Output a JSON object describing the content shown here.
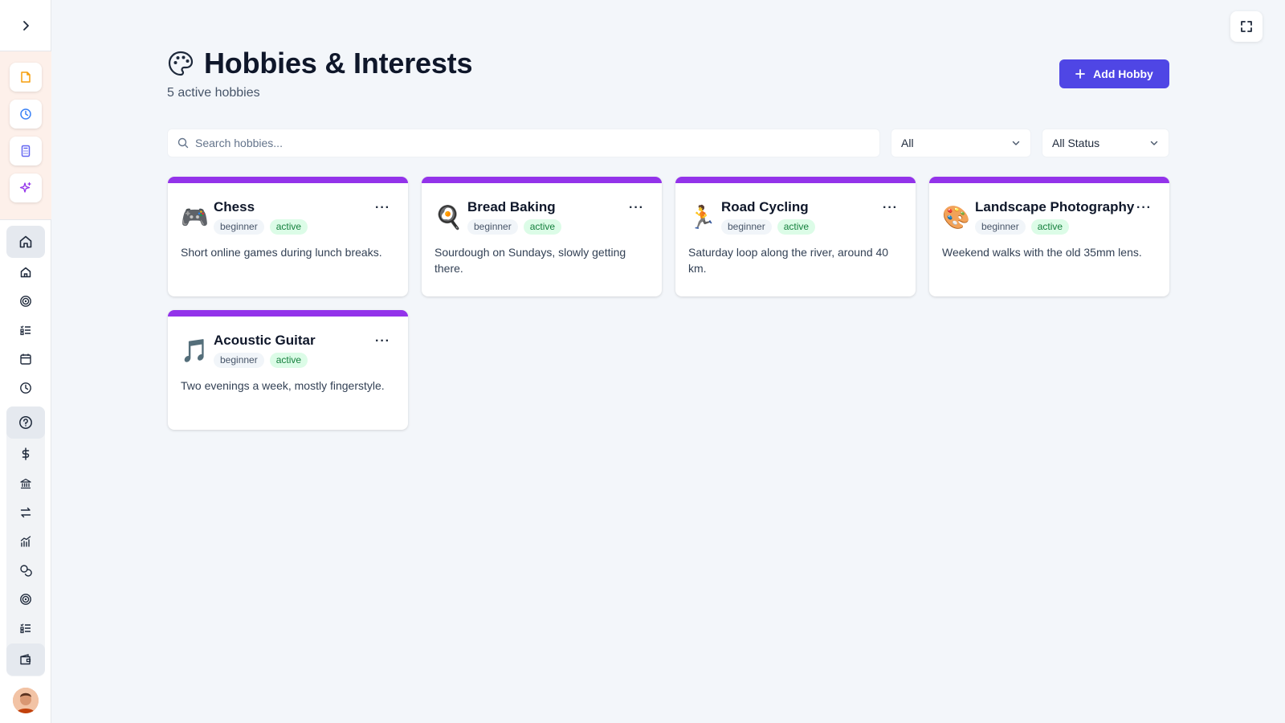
{
  "page": {
    "title": "Hobbies & Interests",
    "title_icon": "palette-icon",
    "subtitle": "5 active hobbies",
    "add_button_label": "Add Hobby"
  },
  "search": {
    "placeholder": "Search hobbies..."
  },
  "filters": {
    "category": "All",
    "status": "All Status"
  },
  "sidebar": {
    "toggle_icon": "chevron-right-icon",
    "quick_actions": [
      "note-icon",
      "clock-icon",
      "calculator-icon",
      "sparkles-icon"
    ],
    "nav_items": [
      "home-icon",
      "house-icon",
      "target-icon",
      "checklist-icon",
      "calendar-icon",
      "clock-icon",
      "help-circle-icon",
      "dollar-icon",
      "bank-icon",
      "transfer-icon",
      "chart-icon",
      "coins-icon",
      "target-icon",
      "checklist-icon",
      "wallet-icon"
    ]
  },
  "hobbies": [
    {
      "name": "Chess",
      "emoji": "🎮",
      "level": "beginner",
      "status": "active",
      "description": "Short online games during lunch breaks."
    },
    {
      "name": "Bread Baking",
      "emoji": "🍳",
      "level": "beginner",
      "status": "active",
      "description": "Sourdough on Sundays, slowly getting there."
    },
    {
      "name": "Road Cycling",
      "emoji": "🏃",
      "level": "beginner",
      "status": "active",
      "description": "Saturday loop along the river, around 40 km."
    },
    {
      "name": "Landscape Photography",
      "emoji": "🎨",
      "level": "beginner",
      "status": "active",
      "description": "Weekend walks with the old 35mm lens."
    },
    {
      "name": "Acoustic Guitar",
      "emoji": "🎵",
      "level": "beginner",
      "status": "active",
      "description": "Two evenings a week, mostly fingerstyle."
    }
  ],
  "colors": {
    "accent": "#4f46e5",
    "card_bar": "#9333ea",
    "status_bg": "#dcfce7",
    "status_text": "#15803d"
  }
}
